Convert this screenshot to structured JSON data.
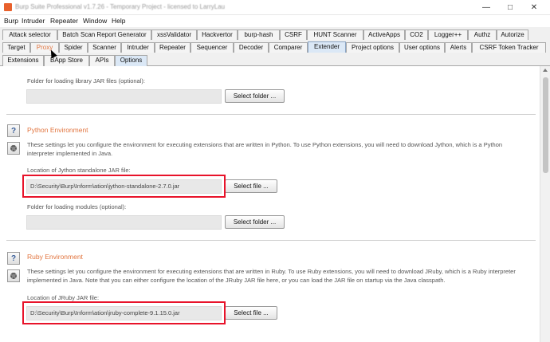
{
  "window": {
    "title": "Burp Suite Professional v1.7.26 - Temporary Project - licensed to LarryLau",
    "minimize_glyph": "—",
    "maximize_glyph": "□",
    "close_glyph": "✕"
  },
  "menu": [
    "Burp",
    "Intruder",
    "Repeater",
    "Window",
    "Help"
  ],
  "tabs_row1": [
    "Attack selector",
    "Batch Scan Report Generator",
    "xssValidator",
    "Hackvertor",
    "burp-hash",
    "CSRF",
    "HUNT Scanner",
    "ActiveApps",
    "CO2",
    "Logger++",
    "Authz",
    "Autorize"
  ],
  "tabs_row2": [
    "Target",
    "Proxy",
    "Spider",
    "Scanner",
    "Intruder",
    "Repeater",
    "Sequencer",
    "Decoder",
    "Comparer",
    "Extender",
    "Project options",
    "User options",
    "Alerts",
    "CSRF Token Tracker"
  ],
  "subtabs": [
    "Extensions",
    "BApp Store",
    "APIs",
    "Options"
  ],
  "java_section": {
    "folder_label": "Folder for loading library JAR files (optional):",
    "folder_value": "",
    "select_button": "Select folder ..."
  },
  "python_section": {
    "title": "Python Environment",
    "description": "These settings let you configure the environment for executing extensions that are written in Python. To use Python extensions, you will need to download Jython, which is a Python interpreter implemented in Java.",
    "jar_label": "Location of Jython standalone JAR file:",
    "jar_value": "D:\\Security\\Burp\\Inform\\ation\\jython-standalone-2.7.0.jar",
    "select_file_button": "Select file ...",
    "modules_label": "Folder for loading modules (optional):",
    "modules_value": "",
    "select_folder_button": "Select folder ..."
  },
  "ruby_section": {
    "title": "Ruby Environment",
    "description": "These settings let you configure the environment for executing extensions that are written in Ruby. To use Ruby extensions, you will need to download JRuby, which is a Ruby interpreter implemented in Java. Note that you can either configure the location of the JRuby JAR file here, or you can load the JAR file on startup via the Java classpath.",
    "jar_label": "Location of JRuby JAR file:",
    "jar_value": "D:\\Security\\Burp\\Inform\\ation\\jruby-complete-9.1.15.0.jar",
    "select_file_button": "Select file ..."
  },
  "help_glyph": "?",
  "colors": {
    "section_title": "#e2753f",
    "highlight_box": "#e8132a",
    "active_tab": "#dbe8f6"
  }
}
